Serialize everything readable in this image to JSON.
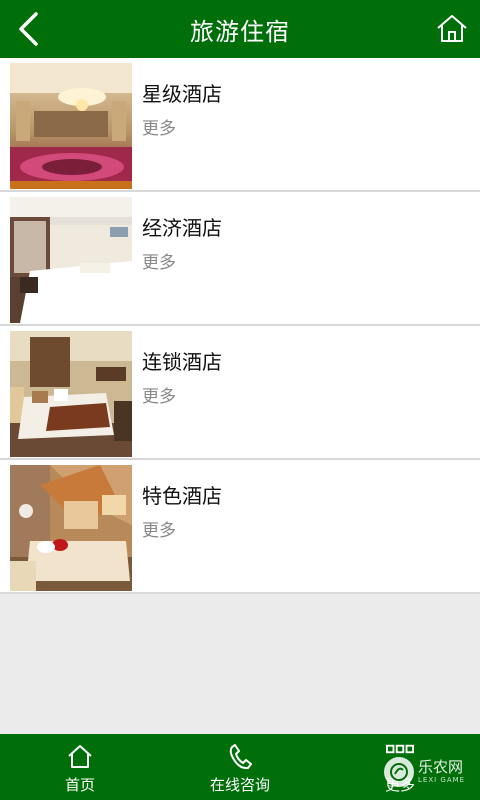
{
  "header": {
    "title": "旅游住宿",
    "back_icon": "chevron-left-icon",
    "home_icon": "home-icon"
  },
  "list": {
    "items": [
      {
        "title": "星级酒店",
        "more": "更多",
        "image": "hotel-lobby-image"
      },
      {
        "title": "经济酒店",
        "more": "更多",
        "image": "economy-room-image"
      },
      {
        "title": "连锁酒店",
        "more": "更多",
        "image": "chain-hotel-room-image"
      },
      {
        "title": "特色酒店",
        "more": "更多",
        "image": "themed-room-image"
      }
    ]
  },
  "bottom_nav": {
    "items": [
      {
        "label": "首页",
        "icon": "home-icon"
      },
      {
        "label": "在线咨询",
        "icon": "phone-icon"
      },
      {
        "label": "更多",
        "icon": "grid-icon"
      }
    ]
  },
  "watermark": {
    "text_cn": "乐农网",
    "text_en": "LEXI GAME"
  },
  "colors": {
    "header_bg": "#006f0a",
    "nav_bg": "#006f0a",
    "page_bg": "#ebebeb",
    "divider": "#d8d8d8",
    "more_text": "#888888"
  }
}
